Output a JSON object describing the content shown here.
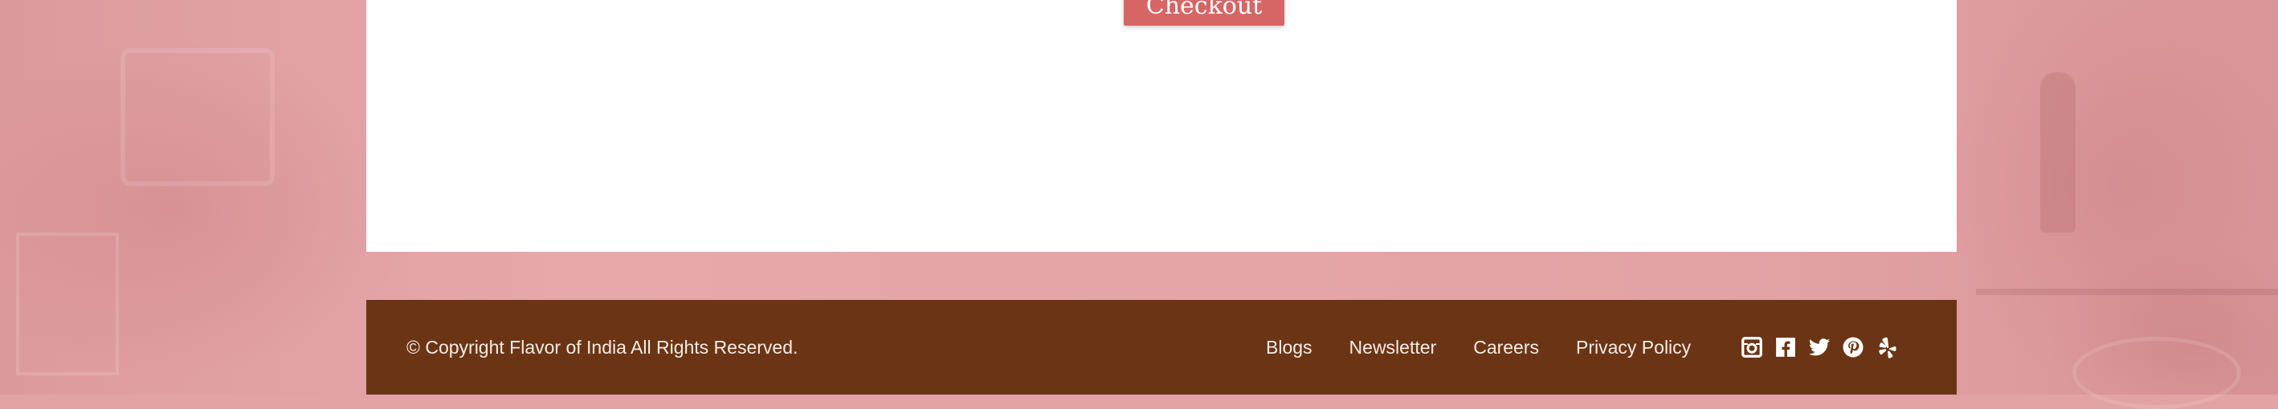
{
  "main": {
    "checkout_label": "Checkout"
  },
  "footer": {
    "copyright": "© Copyright Flavor of India All Rights Reserved.",
    "links": [
      {
        "label": "Blogs"
      },
      {
        "label": "Newsletter"
      },
      {
        "label": "Careers"
      },
      {
        "label": "Privacy Policy"
      }
    ],
    "social_icons": [
      "instagram-icon",
      "facebook-icon",
      "twitter-icon",
      "pinterest-icon",
      "yelp-icon"
    ]
  },
  "colors": {
    "page_background": "#e3a2a5",
    "card_background": "#ffffff",
    "button": "#d66666",
    "footer_background": "#6b3515",
    "footer_text": "#f4ece6"
  }
}
